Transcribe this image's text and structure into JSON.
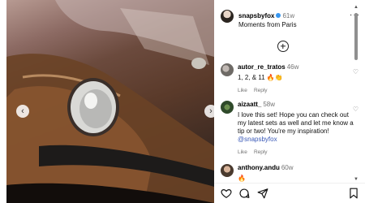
{
  "post": {
    "username": "snapsbyfox",
    "age": "61w",
    "caption": "Moments from Paris"
  },
  "comments": [
    {
      "username": "autor_re_tratos",
      "age": "46w",
      "text": "1, 2, & 11 🔥👏",
      "like_label": "Like",
      "reply_label": "Reply"
    },
    {
      "username": "aizaatt_",
      "age": "58w",
      "text": "I love this set! Hope you can check out my latest sets as well and let me know a tip or two! You're my inspiration!",
      "mention": "@snapsbyfox",
      "like_label": "Like",
      "reply_label": "Reply"
    },
    {
      "username": "anthony.andu",
      "age": "60w",
      "text": "🔥"
    }
  ],
  "icons": {
    "more": "more-options-icon",
    "add": "add-comment-icon",
    "like": "heart-icon",
    "comment": "comment-icon",
    "share": "share-icon",
    "save": "bookmark-icon",
    "prev": "chevron-left-icon",
    "next": "chevron-right-icon"
  },
  "colors": {
    "verified": "#3897f0",
    "mention": "#3b5ab8"
  }
}
